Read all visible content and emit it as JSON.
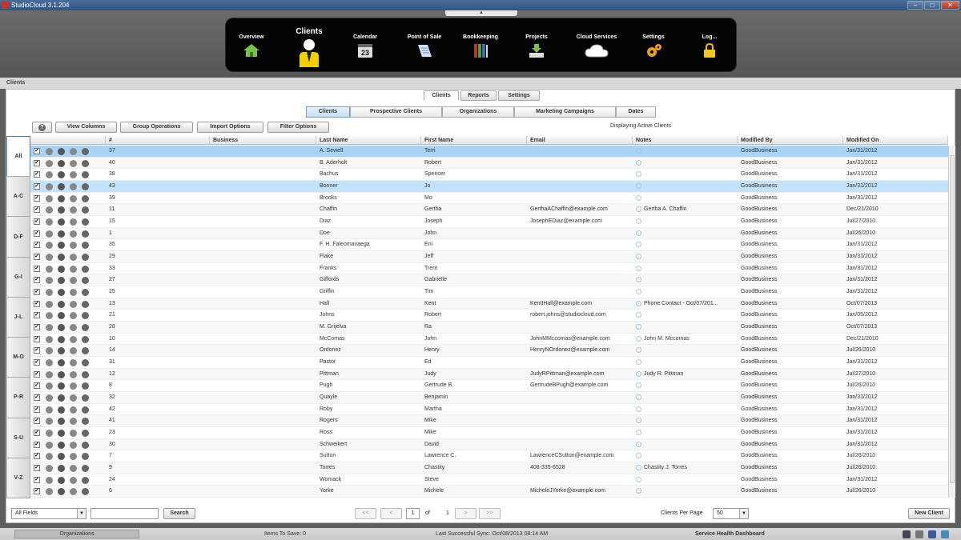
{
  "window": {
    "title": "StudioCloud 3.1.204"
  },
  "nav": {
    "items": [
      {
        "label": "Overview",
        "icon": "house-icon"
      },
      {
        "label": "Clients",
        "icon": "person-icon"
      },
      {
        "label": "Calendar",
        "icon": "calendar-icon",
        "day": "23"
      },
      {
        "label": "Point of Sale",
        "icon": "receipt-icon"
      },
      {
        "label": "Bookkeeping",
        "icon": "books-icon"
      },
      {
        "label": "Projects",
        "icon": "download-tray-icon"
      },
      {
        "label": "Cloud Services",
        "icon": "cloud-icon"
      },
      {
        "label": "Settings",
        "icon": "gears-icon"
      },
      {
        "label": "Log...",
        "icon": "lock-icon"
      }
    ]
  },
  "breadcrumb": "Clients",
  "tabs": [
    "Clients",
    "Reports",
    "Settings"
  ],
  "subtabs": [
    "Clients",
    "Prospective Clients",
    "Organizations",
    "Marketing Campaigns",
    "Dates"
  ],
  "toolbar": {
    "help": "?",
    "view_columns": "View Columns",
    "group_operations": "Group Operations",
    "import_options": "Import Options",
    "filter_options": "Filter Options",
    "displaying": "Displaying Active Clients"
  },
  "letters": [
    "All",
    "A-C",
    "D-F",
    "G-I",
    "J-L",
    "M-O",
    "P-R",
    "S-U",
    "V-Z"
  ],
  "columns": [
    "#",
    "Business",
    "Last Name",
    "First Name",
    "Email",
    "Notes",
    "Modified By",
    "Modified On"
  ],
  "rows": [
    {
      "num": "37",
      "business": "",
      "last": "A. Sewell",
      "first": "Terri",
      "email": "",
      "notes": "",
      "by": "GoodBusiness",
      "on": "Jan/31/2012"
    },
    {
      "num": "40",
      "business": "",
      "last": "B. Aderholt",
      "first": "Robert",
      "email": "",
      "notes": "",
      "by": "GoodBusiness",
      "on": "Jan/31/2012"
    },
    {
      "num": "38",
      "business": "",
      "last": "Bachus",
      "first": "Spencer",
      "email": "",
      "notes": "",
      "by": "GoodBusiness",
      "on": "Jan/31/2012"
    },
    {
      "num": "43",
      "business": "",
      "last": "Bonner",
      "first": "Jo",
      "email": "",
      "notes": "",
      "by": "GoodBusiness",
      "on": "Jan/31/2012"
    },
    {
      "num": "39",
      "business": "",
      "last": "Brooks",
      "first": "Mo",
      "email": "",
      "notes": "",
      "by": "GoodBusiness",
      "on": "Jan/31/2012"
    },
    {
      "num": "11",
      "business": "",
      "last": "Chaffin",
      "first": "Gertha",
      "email": "GerthaAChaffin@example.com",
      "notes": "Gertha A. Chaffin",
      "by": "GoodBusiness",
      "on": "Dec/21/2010"
    },
    {
      "num": "15",
      "business": "",
      "last": "Diaz",
      "first": "Joseph",
      "email": "JosephEDiaz@example.com",
      "notes": "",
      "by": "GoodBusiness",
      "on": "Jul/27/2010"
    },
    {
      "num": "1",
      "business": "",
      "last": "Doe",
      "first": "John",
      "email": "",
      "notes": "",
      "by": "GoodBusiness",
      "on": "Jul/26/2010"
    },
    {
      "num": "35",
      "business": "",
      "last": "F. H. Faleomavaega",
      "first": "Eni",
      "email": "",
      "notes": "",
      "by": "GoodBusiness",
      "on": "Jan/31/2012"
    },
    {
      "num": "29",
      "business": "",
      "last": "Flake",
      "first": "Jeff",
      "email": "",
      "notes": "",
      "by": "GoodBusiness",
      "on": "Jan/31/2012"
    },
    {
      "num": "33",
      "business": "",
      "last": "Franks",
      "first": "Trent",
      "email": "",
      "notes": "",
      "by": "GoodBusiness",
      "on": "Jan/31/2012"
    },
    {
      "num": "27",
      "business": "",
      "last": "Giffords",
      "first": "Gabrielle",
      "email": "",
      "notes": "",
      "by": "GoodBusiness",
      "on": "Jan/31/2012"
    },
    {
      "num": "25",
      "business": "",
      "last": "Griffin",
      "first": "Tim",
      "email": "",
      "notes": "",
      "by": "GoodBusiness",
      "on": "Jan/31/2012"
    },
    {
      "num": "13",
      "business": "",
      "last": "Hall",
      "first": "Kent",
      "email": "KentIHall@example.com",
      "notes": "Phone Contact - Oct/07/201...",
      "by": "GoodBusiness",
      "on": "Oct/07/2013"
    },
    {
      "num": "21",
      "business": "",
      "last": "Johns",
      "first": "Robert",
      "email": "robert.johns@studiocloud.com",
      "notes": "",
      "by": "GoodBusiness",
      "on": "Jan/05/2012"
    },
    {
      "num": "28",
      "business": "",
      "last": "M. Grijelva",
      "first": "Ra",
      "email": "",
      "notes": "",
      "by": "GoodBusiness",
      "on": "Oct/07/2013"
    },
    {
      "num": "10",
      "business": "",
      "last": "McComas",
      "first": "John",
      "email": "JohnMMccomas@example.com",
      "notes": "John M. Mccomas",
      "by": "GoodBusiness",
      "on": "Dec/21/2010"
    },
    {
      "num": "14",
      "business": "",
      "last": "Ordonez",
      "first": "Henry",
      "email": "HenryNOrdonez@example.com",
      "notes": "",
      "by": "GoodBusiness",
      "on": "Jul/26/2010"
    },
    {
      "num": "31",
      "business": "",
      "last": "Pastor",
      "first": "Ed",
      "email": "",
      "notes": "",
      "by": "GoodBusiness",
      "on": "Jan/31/2012"
    },
    {
      "num": "12",
      "business": "",
      "last": "Pittman",
      "first": "Judy",
      "email": "JudyRPittman@example.com",
      "notes": "Judy R. Pittman",
      "by": "GoodBusiness",
      "on": "Jul/27/2010"
    },
    {
      "num": "8",
      "business": "",
      "last": "Pugh",
      "first": "Gertrude B.",
      "email": "GertrudeBPugh@example.com",
      "notes": "",
      "by": "GoodBusiness",
      "on": "Jul/26/2010"
    },
    {
      "num": "32",
      "business": "",
      "last": "Quayle",
      "first": "Benjamin",
      "email": "",
      "notes": "",
      "by": "GoodBusiness",
      "on": "Jan/31/2012"
    },
    {
      "num": "42",
      "business": "",
      "last": "Roby",
      "first": "Martha",
      "email": "",
      "notes": "",
      "by": "GoodBusiness",
      "on": "Jan/31/2012"
    },
    {
      "num": "41",
      "business": "",
      "last": "Rogers",
      "first": "Mike",
      "email": "",
      "notes": "",
      "by": "GoodBusiness",
      "on": "Jan/31/2012"
    },
    {
      "num": "23",
      "business": "",
      "last": "Ross",
      "first": "Mike",
      "email": "",
      "notes": "",
      "by": "GoodBusiness",
      "on": "Jan/31/2012"
    },
    {
      "num": "30",
      "business": "",
      "last": "Schweikert",
      "first": "David",
      "email": "",
      "notes": "",
      "by": "GoodBusiness",
      "on": "Jan/31/2012"
    },
    {
      "num": "7",
      "business": "",
      "last": "Sutton",
      "first": "Lawrence C.",
      "email": "LawrenceCSutton@example.com",
      "notes": "",
      "by": "GoodBusiness",
      "on": "Jul/26/2010"
    },
    {
      "num": "9",
      "business": "",
      "last": "Torres",
      "first": "Chastity",
      "email": "408-335-6528",
      "notes": "Chastity J. Torres",
      "by": "GoodBusiness",
      "on": "Jul/26/2010"
    },
    {
      "num": "24",
      "business": "",
      "last": "Womack",
      "first": "Steve",
      "email": "",
      "notes": "",
      "by": "GoodBusiness",
      "on": "Jan/31/2012"
    },
    {
      "num": "6",
      "business": "",
      "last": "Yorke",
      "first": "Michele",
      "email": "MicheleJYorke@example.com",
      "notes": "",
      "by": "GoodBusiness",
      "on": "Jul/26/2010"
    }
  ],
  "footer": {
    "field_select": "All Fields",
    "search_value": "",
    "search_button": "Search",
    "first": "<<",
    "prev": "<",
    "page": "1",
    "of": "of",
    "total_pages": "1",
    "next": ">",
    "last": ">>",
    "per_page_label": "Clients Per Page",
    "per_page": "50",
    "new_client": "New Client"
  },
  "status": {
    "organizations": "Organizations",
    "items_to_save": "Items To Save: 0",
    "last_sync": "Last Successful Sync: Oct/08/2013 08:14 AM",
    "health": "Service Health Dashboard"
  },
  "colors": {
    "accent": "#2f5585",
    "selected_row": "#a8d3f5",
    "nav_bg": "#050505"
  }
}
